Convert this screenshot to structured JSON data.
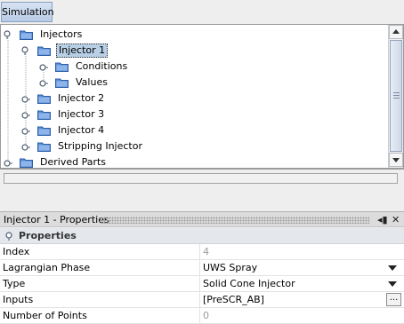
{
  "toolbar": {
    "simulation_tab": "Simulation"
  },
  "tree": {
    "items": [
      {
        "label": "Injectors",
        "level": 0,
        "expanded": true
      },
      {
        "label": "Injector 1",
        "level": 1,
        "expanded": true,
        "selected": true
      },
      {
        "label": "Conditions",
        "level": 2
      },
      {
        "label": "Values",
        "level": 2
      },
      {
        "label": "Injector 2",
        "level": 1
      },
      {
        "label": "Injector 3",
        "level": 1
      },
      {
        "label": "Injector 4",
        "level": 1
      },
      {
        "label": "Stripping Injector",
        "level": 1
      },
      {
        "label": "Derived Parts",
        "level": 0
      }
    ]
  },
  "properties_panel": {
    "title": "Injector 1 - Properties",
    "section": "Properties",
    "rows": [
      {
        "name": "Index",
        "value": "4",
        "readonly": true
      },
      {
        "name": "Lagrangian Phase",
        "value": "UWS Spray",
        "control": "dropdown"
      },
      {
        "name": "Type",
        "value": "Solid Cone Injector",
        "control": "dropdown"
      },
      {
        "name": "Inputs",
        "value": "[PreSCR_AB]",
        "control": "ellipsis",
        "button_label": "..."
      },
      {
        "name": "Number of Points",
        "value": "0",
        "readonly": true
      }
    ]
  },
  "colors": {
    "folder": "#3f76c9",
    "selection": "#b8cfe5",
    "readonly_text": "#9a9a9a"
  }
}
